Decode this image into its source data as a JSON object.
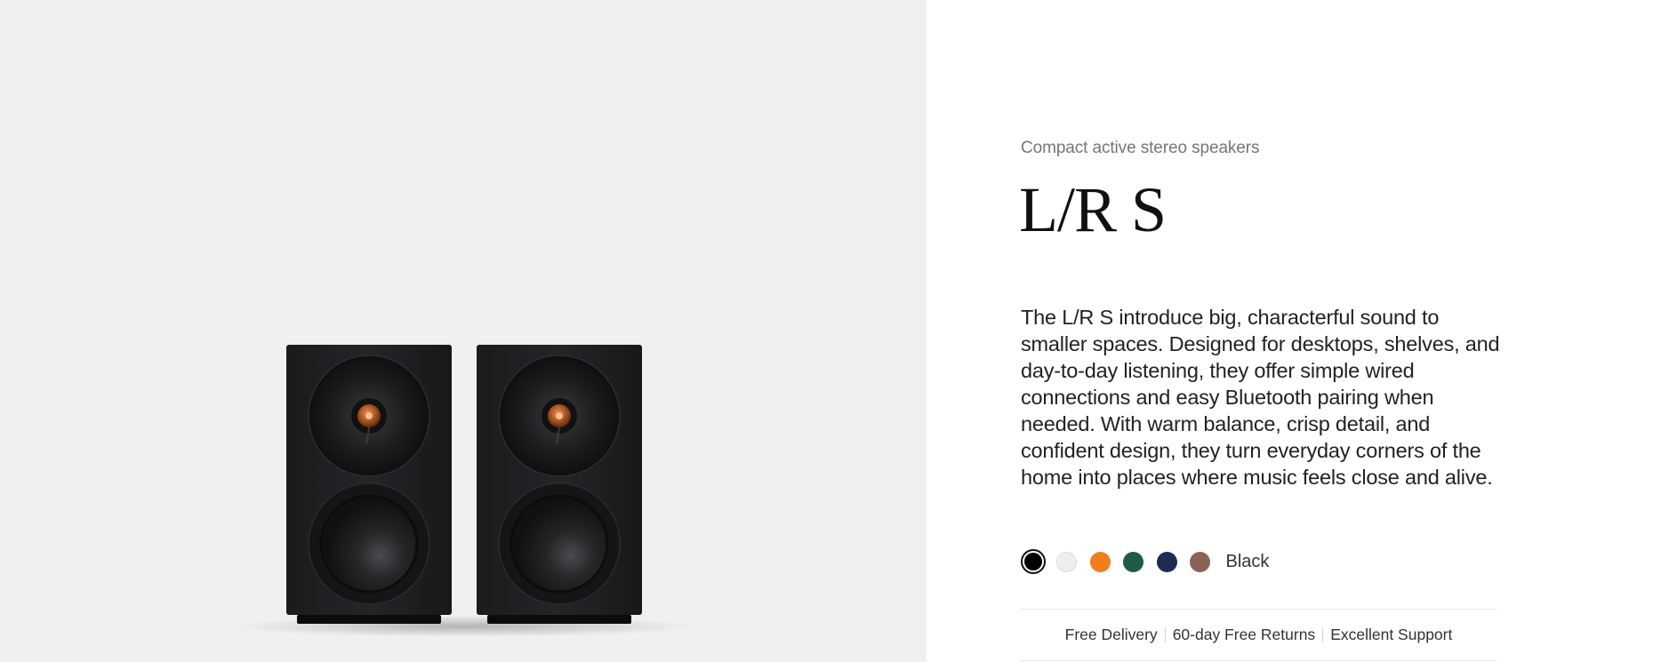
{
  "product": {
    "subtitle": "Compact active stereo speakers",
    "title": "L/R S",
    "description": "The L/R S introduce big, characterful sound to smaller spaces. Designed for desktops, shelves, and day-to-day listening, they offer simple wired connections and easy Bluetooth pairing when needed. With warm balance, crisp detail, and confident design, they turn everyday corners of the home into places where music feels close and alive."
  },
  "colors": {
    "selected_label": "Black",
    "swatches": [
      {
        "name": "black",
        "hex": "#000000",
        "selected": true
      },
      {
        "name": "white",
        "hex": "#eeeeee"
      },
      {
        "name": "orange",
        "hex": "#f07d1e"
      },
      {
        "name": "green",
        "hex": "#1f5b45"
      },
      {
        "name": "navy",
        "hex": "#1d2c54"
      },
      {
        "name": "brown",
        "hex": "#8a6356"
      }
    ]
  },
  "perks": [
    "Free Delivery",
    "60-day Free Returns",
    "Excellent Support"
  ],
  "theme": {
    "gallery_bg": "#f0f0f0",
    "speaker_body": "#1e1f21",
    "tweeter_accent": "#c1622a"
  }
}
